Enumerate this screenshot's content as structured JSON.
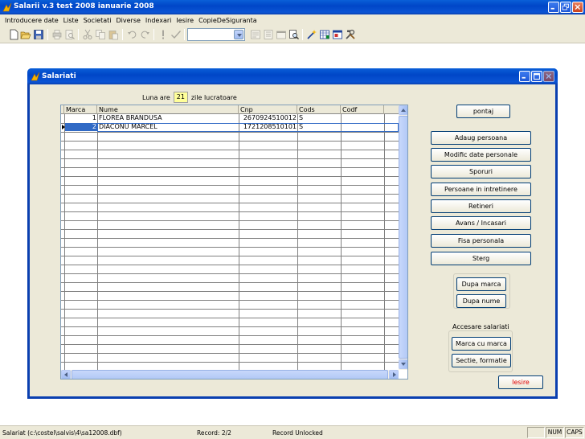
{
  "window": {
    "title": "Salarii v.3  test 2008 ianuarie 2008"
  },
  "menu": [
    "Introducere date",
    "Liste",
    "Societati",
    "Diverse",
    "Indexari",
    "Iesire",
    "CopieDeSiguranta"
  ],
  "toolbar": {
    "combo_value": "",
    "icons": [
      "new-icon",
      "open-icon",
      "save-icon",
      "print-icon",
      "print-preview-icon",
      "cut-icon",
      "copy-icon",
      "paste-icon",
      "undo-icon",
      "redo-icon",
      "exclamation-icon",
      "check-icon",
      "form-icon",
      "report-icon",
      "properties-icon",
      "zoom-icon",
      "wizard-icon",
      "spreadsheet-icon",
      "window-icon",
      "tools-icon"
    ]
  },
  "child": {
    "title": "Salariati",
    "luna_prefix": "Luna are",
    "working_days": "21",
    "luna_suffix": "zile lucratoare",
    "grid": {
      "columns": [
        "Marca",
        "Nume",
        "Cnp",
        "Cods",
        "Codf"
      ],
      "rows": [
        {
          "marca": "1",
          "nume": "FLOREA BRANDUSA",
          "cnp": "2670924510012",
          "cods": "S",
          "codf": ""
        },
        {
          "marca": "2",
          "nume": "DIACONU MARCEL",
          "cnp": "1721208510101",
          "cods": "S",
          "codf": ""
        }
      ],
      "selected_row": 2
    },
    "buttons": {
      "pontaj": "pontaj",
      "adaug": "Adaug persoana",
      "modific": "Modific date personale",
      "sporuri": "Sporuri",
      "persoane": "Persoane in intretinere",
      "retineri": "Retineri",
      "avans": "Avans / Incasari",
      "fisa": "Fisa personala",
      "sterg": "Sterg",
      "dupa_marca": "Dupa marca",
      "dupa_nume": "Dupa nume",
      "marca_cu_marca": "Marca cu marca",
      "sectie": "Sectie, formatie",
      "iesire": "Iesire"
    },
    "accesare_label": "Accesare salariati"
  },
  "status": {
    "path": "Salariat (c:\\costel\\salvis\\4\\sa12008.dbf)",
    "record": "Record: 2/2",
    "lock": "Record Unlocked",
    "num": "NUM",
    "caps": "CAPS"
  },
  "colors": {
    "titlebar": "#0046c7",
    "selection": "#316ac5",
    "days_bg": "#ffff99",
    "iesire_text": "#e00000"
  }
}
